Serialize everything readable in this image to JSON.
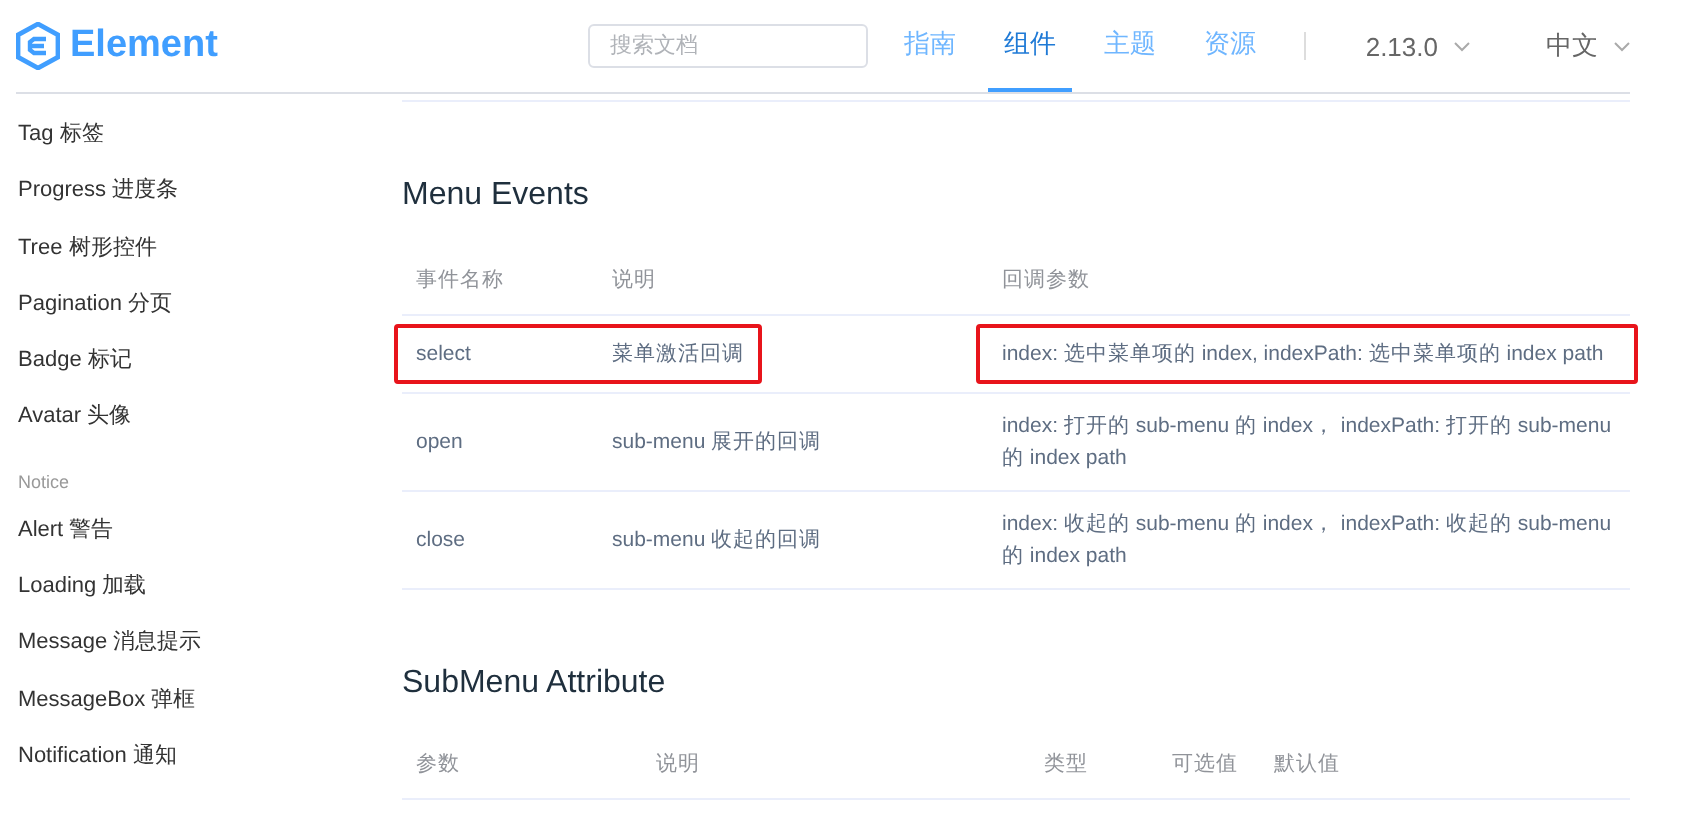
{
  "header": {
    "logo": "Element",
    "search": {
      "placeholder": "搜索文档"
    },
    "nav": [
      {
        "label": "指南",
        "selected": false
      },
      {
        "label": "组件",
        "selected": true
      },
      {
        "label": "主题",
        "selected": false
      },
      {
        "label": "资源",
        "selected": false
      }
    ],
    "version": "2.13.0",
    "language": "中文"
  },
  "sidebar": {
    "groups": [
      {
        "items": [
          "Tag 标签",
          "Progress 进度条",
          "Tree 树形控件",
          "Pagination 分页",
          "Badge 标记",
          "Avatar 头像"
        ]
      },
      {
        "title": "Notice",
        "items": [
          "Alert 警告",
          "Loading 加载",
          "Message 消息提示",
          "MessageBox 弹框",
          "Notification 通知"
        ]
      }
    ]
  },
  "sections": [
    {
      "title": "Menu Events",
      "columns": [
        "事件名称",
        "说明",
        "回调参数"
      ],
      "rows": [
        {
          "cells": [
            "select",
            "菜单激活回调",
            "index: 选中菜单项的 index, indexPath: 选中菜单项的 index path"
          ],
          "highlighted": true
        },
        {
          "cells": [
            "open",
            "sub-menu 展开的回调",
            "index: 打开的 sub-menu 的 index， indexPath: 打开的 sub-menu 的 index path"
          ],
          "highlighted": false
        },
        {
          "cells": [
            "close",
            "sub-menu 收起的回调",
            "index: 收起的 sub-menu 的 index， indexPath: 收起的 sub-menu 的 index path"
          ],
          "highlighted": false
        }
      ]
    },
    {
      "title": "SubMenu Attribute",
      "columns": [
        "参数",
        "说明",
        "类型",
        "可选值",
        "默认值"
      ]
    }
  ]
}
